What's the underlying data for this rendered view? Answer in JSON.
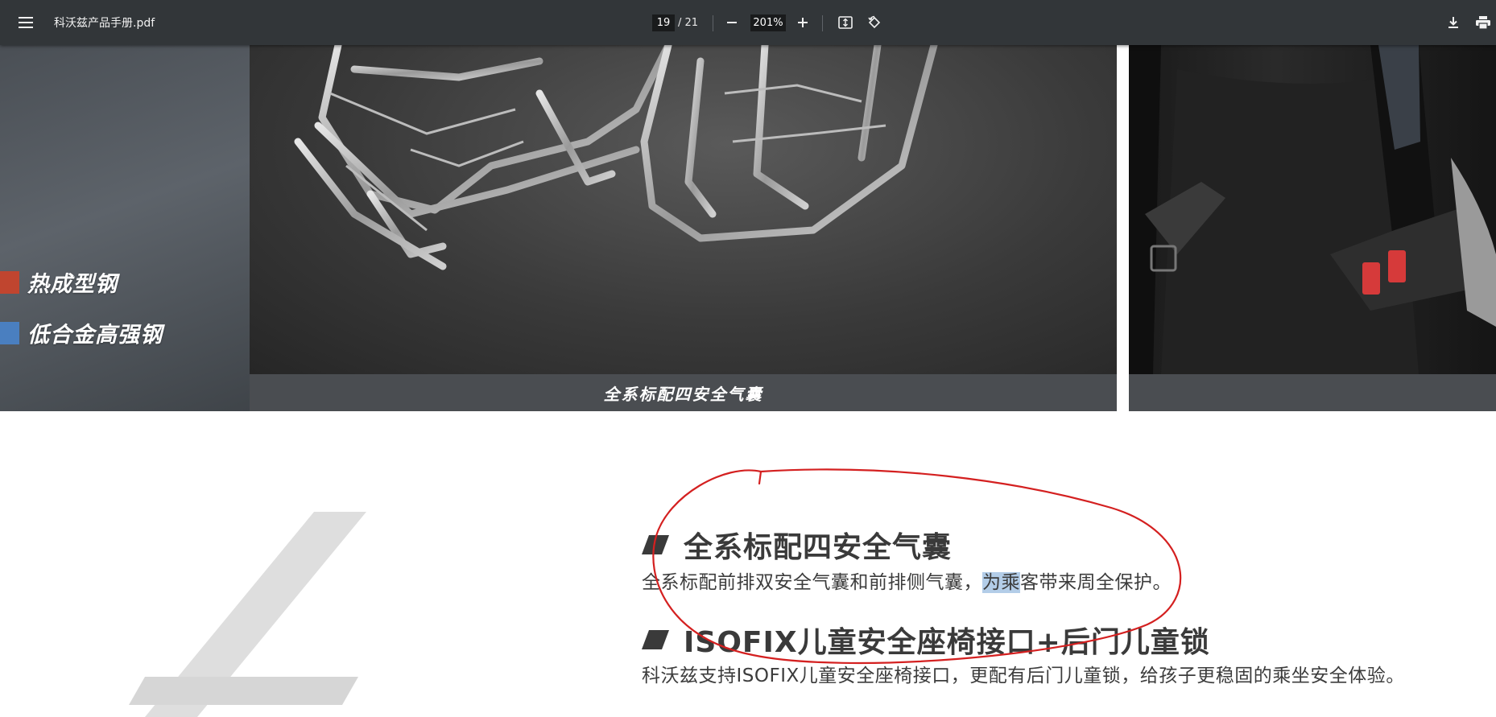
{
  "toolbar": {
    "file_name": "科沃兹产品手册.pdf",
    "current_page": "19",
    "page_total": "/ 21",
    "zoom": "201%",
    "icons": [
      "menu-icon",
      "zoom-out-icon",
      "zoom-in-icon",
      "fit-page-icon",
      "rotate-icon",
      "download-icon",
      "print-icon"
    ]
  },
  "page": {
    "legend": [
      {
        "label": "热成型钢",
        "color": "#c0452f"
      },
      {
        "label": "低合金高强钢",
        "color": "#4a7fc0"
      }
    ],
    "caption": "全系标配四安全气囊",
    "sections": [
      {
        "title": "全系标配四安全气囊",
        "body_before": "全系标配前排双安全气囊和前排侧气囊，",
        "body_selected": "为乘",
        "body_after": "客带来周全保护。"
      },
      {
        "title": "ISOFIX儿童安全座椅接口+后门儿童锁",
        "body": "科沃兹支持ISOFIX儿童安全座椅接口，更配有后门儿童锁，给孩子更稳固的乘坐安全体验。"
      }
    ],
    "annotation_color": "#d42020",
    "section_mark_color": "#3a3a3a",
    "highlight_color": "#b3cde8"
  }
}
